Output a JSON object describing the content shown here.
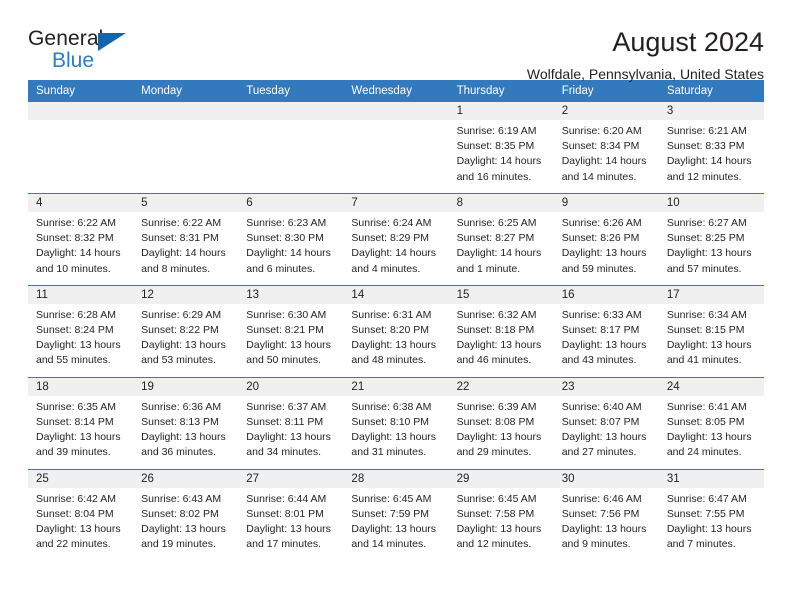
{
  "brand": {
    "name_top": "General",
    "name_bottom": "Blue",
    "triangle_color": "#1464aa",
    "blue_text_color": "#2e7ec1"
  },
  "header": {
    "title": "August 2024",
    "location": "Wolfdale, Pennsylvania, United States"
  },
  "theme": {
    "header_blue": "#3379bd",
    "daynum_band": "#f0f0f0",
    "text": "#231f20"
  },
  "weekday_headers": [
    "Sunday",
    "Monday",
    "Tuesday",
    "Wednesday",
    "Thursday",
    "Friday",
    "Saturday"
  ],
  "labels": {
    "sunrise": "Sunrise:",
    "sunset": "Sunset:",
    "daylight": "Daylight:"
  },
  "weeks": [
    [
      {
        "day": "",
        "lines": [
          "",
          "",
          "",
          ""
        ]
      },
      {
        "day": "",
        "lines": [
          "",
          "",
          "",
          ""
        ]
      },
      {
        "day": "",
        "lines": [
          "",
          "",
          "",
          ""
        ]
      },
      {
        "day": "",
        "lines": [
          "",
          "",
          "",
          ""
        ]
      },
      {
        "day": "1",
        "lines": [
          "Sunrise: 6:19 AM",
          "Sunset: 8:35 PM",
          "Daylight: 14 hours",
          "and 16 minutes."
        ]
      },
      {
        "day": "2",
        "lines": [
          "Sunrise: 6:20 AM",
          "Sunset: 8:34 PM",
          "Daylight: 14 hours",
          "and 14 minutes."
        ]
      },
      {
        "day": "3",
        "lines": [
          "Sunrise: 6:21 AM",
          "Sunset: 8:33 PM",
          "Daylight: 14 hours",
          "and 12 minutes."
        ]
      }
    ],
    [
      {
        "day": "4",
        "lines": [
          "Sunrise: 6:22 AM",
          "Sunset: 8:32 PM",
          "Daylight: 14 hours",
          "and 10 minutes."
        ]
      },
      {
        "day": "5",
        "lines": [
          "Sunrise: 6:22 AM",
          "Sunset: 8:31 PM",
          "Daylight: 14 hours",
          "and 8 minutes."
        ]
      },
      {
        "day": "6",
        "lines": [
          "Sunrise: 6:23 AM",
          "Sunset: 8:30 PM",
          "Daylight: 14 hours",
          "and 6 minutes."
        ]
      },
      {
        "day": "7",
        "lines": [
          "Sunrise: 6:24 AM",
          "Sunset: 8:29 PM",
          "Daylight: 14 hours",
          "and 4 minutes."
        ]
      },
      {
        "day": "8",
        "lines": [
          "Sunrise: 6:25 AM",
          "Sunset: 8:27 PM",
          "Daylight: 14 hours",
          "and 1 minute."
        ]
      },
      {
        "day": "9",
        "lines": [
          "Sunrise: 6:26 AM",
          "Sunset: 8:26 PM",
          "Daylight: 13 hours",
          "and 59 minutes."
        ]
      },
      {
        "day": "10",
        "lines": [
          "Sunrise: 6:27 AM",
          "Sunset: 8:25 PM",
          "Daylight: 13 hours",
          "and 57 minutes."
        ]
      }
    ],
    [
      {
        "day": "11",
        "lines": [
          "Sunrise: 6:28 AM",
          "Sunset: 8:24 PM",
          "Daylight: 13 hours",
          "and 55 minutes."
        ]
      },
      {
        "day": "12",
        "lines": [
          "Sunrise: 6:29 AM",
          "Sunset: 8:22 PM",
          "Daylight: 13 hours",
          "and 53 minutes."
        ]
      },
      {
        "day": "13",
        "lines": [
          "Sunrise: 6:30 AM",
          "Sunset: 8:21 PM",
          "Daylight: 13 hours",
          "and 50 minutes."
        ]
      },
      {
        "day": "14",
        "lines": [
          "Sunrise: 6:31 AM",
          "Sunset: 8:20 PM",
          "Daylight: 13 hours",
          "and 48 minutes."
        ]
      },
      {
        "day": "15",
        "lines": [
          "Sunrise: 6:32 AM",
          "Sunset: 8:18 PM",
          "Daylight: 13 hours",
          "and 46 minutes."
        ]
      },
      {
        "day": "16",
        "lines": [
          "Sunrise: 6:33 AM",
          "Sunset: 8:17 PM",
          "Daylight: 13 hours",
          "and 43 minutes."
        ]
      },
      {
        "day": "17",
        "lines": [
          "Sunrise: 6:34 AM",
          "Sunset: 8:15 PM",
          "Daylight: 13 hours",
          "and 41 minutes."
        ]
      }
    ],
    [
      {
        "day": "18",
        "lines": [
          "Sunrise: 6:35 AM",
          "Sunset: 8:14 PM",
          "Daylight: 13 hours",
          "and 39 minutes."
        ]
      },
      {
        "day": "19",
        "lines": [
          "Sunrise: 6:36 AM",
          "Sunset: 8:13 PM",
          "Daylight: 13 hours",
          "and 36 minutes."
        ]
      },
      {
        "day": "20",
        "lines": [
          "Sunrise: 6:37 AM",
          "Sunset: 8:11 PM",
          "Daylight: 13 hours",
          "and 34 minutes."
        ]
      },
      {
        "day": "21",
        "lines": [
          "Sunrise: 6:38 AM",
          "Sunset: 8:10 PM",
          "Daylight: 13 hours",
          "and 31 minutes."
        ]
      },
      {
        "day": "22",
        "lines": [
          "Sunrise: 6:39 AM",
          "Sunset: 8:08 PM",
          "Daylight: 13 hours",
          "and 29 minutes."
        ]
      },
      {
        "day": "23",
        "lines": [
          "Sunrise: 6:40 AM",
          "Sunset: 8:07 PM",
          "Daylight: 13 hours",
          "and 27 minutes."
        ]
      },
      {
        "day": "24",
        "lines": [
          "Sunrise: 6:41 AM",
          "Sunset: 8:05 PM",
          "Daylight: 13 hours",
          "and 24 minutes."
        ]
      }
    ],
    [
      {
        "day": "25",
        "lines": [
          "Sunrise: 6:42 AM",
          "Sunset: 8:04 PM",
          "Daylight: 13 hours",
          "and 22 minutes."
        ]
      },
      {
        "day": "26",
        "lines": [
          "Sunrise: 6:43 AM",
          "Sunset: 8:02 PM",
          "Daylight: 13 hours",
          "and 19 minutes."
        ]
      },
      {
        "day": "27",
        "lines": [
          "Sunrise: 6:44 AM",
          "Sunset: 8:01 PM",
          "Daylight: 13 hours",
          "and 17 minutes."
        ]
      },
      {
        "day": "28",
        "lines": [
          "Sunrise: 6:45 AM",
          "Sunset: 7:59 PM",
          "Daylight: 13 hours",
          "and 14 minutes."
        ]
      },
      {
        "day": "29",
        "lines": [
          "Sunrise: 6:45 AM",
          "Sunset: 7:58 PM",
          "Daylight: 13 hours",
          "and 12 minutes."
        ]
      },
      {
        "day": "30",
        "lines": [
          "Sunrise: 6:46 AM",
          "Sunset: 7:56 PM",
          "Daylight: 13 hours",
          "and 9 minutes."
        ]
      },
      {
        "day": "31",
        "lines": [
          "Sunrise: 6:47 AM",
          "Sunset: 7:55 PM",
          "Daylight: 13 hours",
          "and 7 minutes."
        ]
      }
    ]
  ]
}
